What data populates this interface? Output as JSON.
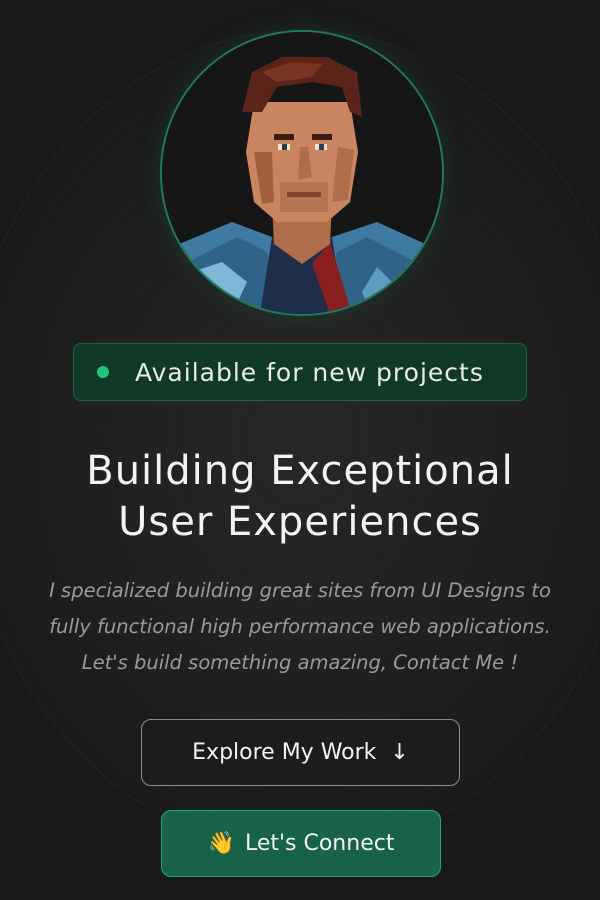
{
  "avatar": {
    "alt": "pixel-art portrait",
    "icon": "pixel-portrait"
  },
  "status_badge": {
    "text": "Available for new projects",
    "dot_color": "#22c47c"
  },
  "hero": {
    "headline_line1": "Building Exceptional",
    "headline_line2": "User Experiences",
    "subtext_line1": "I specialized building great sites from UI Designs to",
    "subtext_line2": "fully functional high performance web applications.",
    "subtext_line3": "Let's build something amazing, Contact Me !"
  },
  "actions": {
    "explore_label": "Explore My Work",
    "explore_icon": "↓",
    "connect_label": "Let's Connect",
    "connect_icon": "👋"
  },
  "colors": {
    "accent_green": "#186347",
    "accent_border": "#2aa474",
    "background": "#1b1b1b"
  }
}
